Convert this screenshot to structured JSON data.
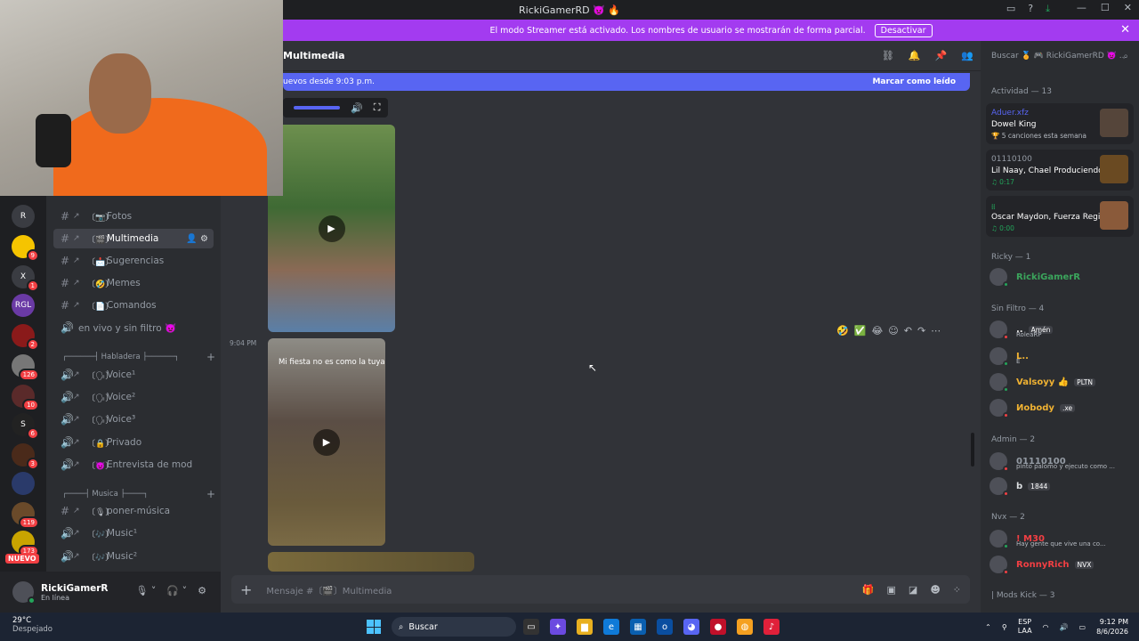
{
  "window": {
    "title": "RickiGamerRD 👿 🔥"
  },
  "banner": {
    "text": "El modo Streamer está activado. Los nombres de usuario se mostrarán de forma parcial.",
    "button": "Desactivar"
  },
  "servers": [
    {
      "label": "R",
      "badge": ""
    },
    {
      "label": "",
      "badge": "9"
    },
    {
      "label": "X",
      "badge": "1"
    },
    {
      "label": "RGL",
      "badge": ""
    },
    {
      "label": "",
      "badge": "2"
    },
    {
      "label": "",
      "badge": "126"
    },
    {
      "label": "",
      "badge": "10"
    },
    {
      "label": "S",
      "badge": "6"
    },
    {
      "label": "",
      "badge": "3"
    },
    {
      "label": "",
      "badge": ""
    },
    {
      "label": "",
      "badge": "119"
    },
    {
      "label": "",
      "badge": "173"
    }
  ],
  "nuevo_label": "NUEVO",
  "channels": [
    {
      "label": "Fotos",
      "emoji": "〔📷〕",
      "active": false
    },
    {
      "label": "Multimedia",
      "emoji": "〔🎬〕",
      "active": true
    },
    {
      "label": "Sugerencias",
      "emoji": "〔📩〕",
      "active": false
    },
    {
      "label": "Memes",
      "emoji": "〔🤣〕",
      "active": false
    },
    {
      "label": "Comandos",
      "emoji": "〔📄〕",
      "active": false
    },
    {
      "label": "en vivo y sin filtro 👿",
      "emoji": "",
      "active": false
    }
  ],
  "categories": {
    "habladera": "┌──────┤ Habladera ├──────┐",
    "musica": "┌────┤ Musica ├────┐"
  },
  "voice_channels": [
    {
      "label": "Voice¹",
      "emoji": "〔🗣〕"
    },
    {
      "label": "Voice²",
      "emoji": "〔🗣〕"
    },
    {
      "label": "Voice³",
      "emoji": "〔🗣〕"
    },
    {
      "label": "Privado",
      "emoji": "〔🔒〕"
    },
    {
      "label": "Entrevista de mod",
      "emoji": "〔👿〕"
    }
  ],
  "music_channels": [
    {
      "label": "poner-música",
      "emoji": "〔🎙〕"
    },
    {
      "label": "Music¹",
      "emoji": "〔🎶〕"
    },
    {
      "label": "Music²",
      "emoji": "〔🎶〕"
    }
  ],
  "user": {
    "name": "RickiGamerR",
    "status": "En línea"
  },
  "chat": {
    "channel": "Multimedia",
    "new_bar": "uevos desde 9:03 p.m.",
    "mark_read": "Marcar como leído",
    "timestamp": "9:04 PM",
    "video2_caption": "Mi fiesta no es como la tuya",
    "composer_placeholder": "Mensaje #〔🎬〕Multimedia"
  },
  "members_panel": {
    "search": "Buscar 🏅 🎮 RickiGamerRD 👿 ...",
    "activity_header": "Actividad — 13",
    "activities": [
      {
        "l1": "Aduer.xfz",
        "l2": "Dowel King",
        "l3": "🏆 5 canciones esta semana"
      },
      {
        "l1": "01110100",
        "l2": "Lil Naay, Chael Produciendo",
        "l3": "♫ 0:17"
      },
      {
        "l1": "᎒᎒",
        "l2": "Oscar Maydon, Fuerza Regi...",
        "l3": "♫ 0:00"
      }
    ],
    "ricky_header": "Ricky — 1",
    "ricky_members": [
      {
        "name": "RickiGamerR",
        "color": "#3ba55c",
        "sub": "",
        "tag": ""
      }
    ],
    "sinfiltro_header": "Sin Filtro — 4",
    "sinfiltro_members": [
      {
        "name": "..",
        "color": "#e8e8e8",
        "sub": "RoleaRP",
        "tag": "Amén"
      },
      {
        "name": "L..",
        "color": "#f0b232",
        "sub": "E",
        "tag": ""
      },
      {
        "name": "Valsoyy 👍",
        "color": "#f0b232",
        "sub": "",
        "tag": "PLTN"
      },
      {
        "name": "Иobody",
        "color": "#f0b232",
        "sub": "",
        "tag": ".xe"
      }
    ],
    "admin_header": "Admin — 2",
    "admin_members": [
      {
        "name": "01110100",
        "color": "#949ba4",
        "sub": "pinto palomo y ejecuto como ...",
        "tag": ""
      },
      {
        "name": "b",
        "color": "#dbdee1",
        "sub": "",
        "tag": "1844"
      }
    ],
    "nvx_header": "Nvx — 2",
    "nvx_members": [
      {
        "name": "! M30",
        "color": "#f23f43",
        "sub": "Hay gente que vive una co...",
        "tag": ""
      },
      {
        "name": "RonnyRich",
        "color": "#f23f43",
        "sub": "",
        "tag": "NVX"
      }
    ],
    "mods_header": "| Mods Kick — 3"
  },
  "taskbar": {
    "temp": "29°C",
    "weather": "Despejado",
    "search": "Buscar",
    "lang1": "ESP",
    "lang2": "LAA",
    "time": "9:12 PM",
    "date": "8/6/2026"
  }
}
